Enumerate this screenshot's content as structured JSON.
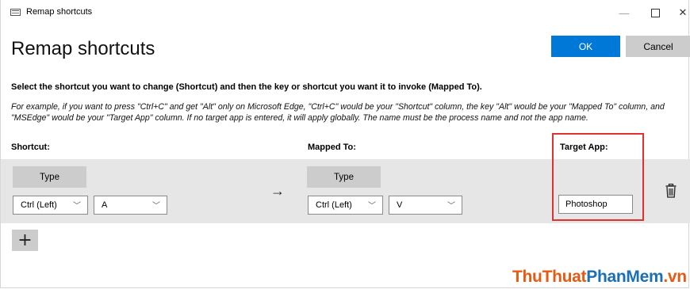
{
  "window": {
    "title": "Remap shortcuts",
    "minimize": "—",
    "close": "✕"
  },
  "page": {
    "heading": "Remap shortcuts",
    "ok_label": "OK",
    "cancel_label": "Cancel",
    "instruction": "Select the shortcut you want to change (Shortcut) and then the key or shortcut you want it to invoke (Mapped To).",
    "example": "For example, if you want to press \"Ctrl+C\" and get \"Alt\" only on Microsoft Edge, \"Ctrl+C\" would be your \"Shortcut\" column, the key \"Alt\" would be your \"Mapped To\" column, and \"MSEdge\" would be your \"Target App\" column. If no target app is entered, it will apply globally. The name must be the process name and not the app name."
  },
  "columns": {
    "shortcut": "Shortcut:",
    "mapped_to": "Mapped To:",
    "target_app": "Target App:"
  },
  "row": {
    "shortcut": {
      "type_label": "Type",
      "modifier": "Ctrl (Left)",
      "key": "A"
    },
    "arrow": "→",
    "mapped": {
      "type_label": "Type",
      "modifier": "Ctrl (Left)",
      "key": "V"
    },
    "target_app": "Photoshop"
  },
  "add_label": "+",
  "watermark": {
    "part1": "ThuThuat",
    "part2": "PhanMem",
    "part3": ".vn"
  },
  "colors": {
    "accent": "#0078d7",
    "button_gray": "#cccccc",
    "row_bg": "#e6e6e6",
    "highlight": "#e03030"
  }
}
